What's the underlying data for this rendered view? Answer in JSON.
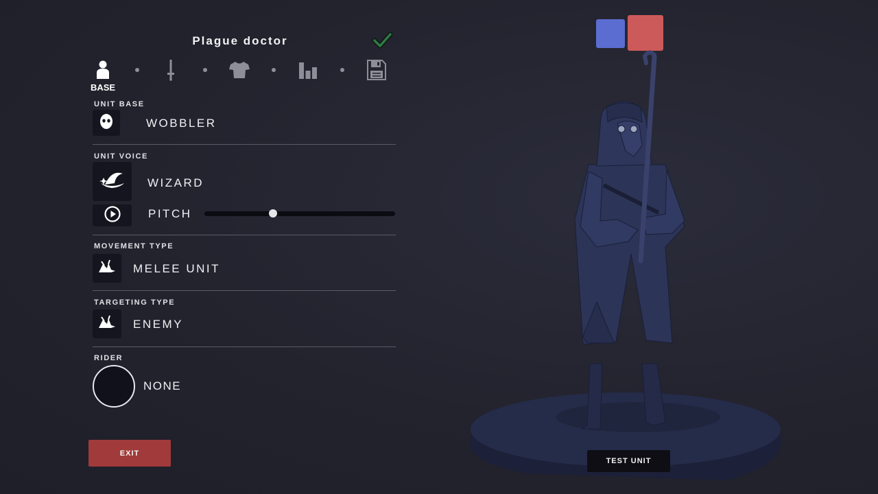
{
  "unit": {
    "name": "Plague doctor"
  },
  "tabs": [
    {
      "id": "base",
      "label": "BASE",
      "icon": "person-icon",
      "active": true
    },
    {
      "id": "weapons",
      "icon": "sword-icon"
    },
    {
      "id": "clothing",
      "icon": "shirt-icon"
    },
    {
      "id": "stats",
      "icon": "bar-chart-icon"
    },
    {
      "id": "save",
      "icon": "floppy-disk-icon"
    }
  ],
  "sections": {
    "unit_base": {
      "label": "UNIT BASE",
      "value": "WOBBLER",
      "icon": "wobbler-head-icon"
    },
    "unit_voice": {
      "label": "UNIT VOICE",
      "value": "WIZARD",
      "icon": "wizard-hat-icon",
      "pitch": {
        "label": "PITCH",
        "value": 0.36
      }
    },
    "movement_type": {
      "label": "MOVEMENT TYPE",
      "value": "MELEE UNIT",
      "icon": "melee-unit-icon"
    },
    "targeting_type": {
      "label": "TARGETING TYPE",
      "value": "ENEMY",
      "icon": "target-enemy-icon"
    },
    "rider": {
      "label": "RIDER",
      "value": "NONE"
    }
  },
  "buttons": {
    "exit": "EXIT",
    "test_unit": "TEST UNIT"
  },
  "team_colors": {
    "blue": "#5b6dd1",
    "red": "#cc5a5a"
  },
  "accent": {
    "exit_button": "#a13a3a",
    "check": "#2f7a44"
  }
}
